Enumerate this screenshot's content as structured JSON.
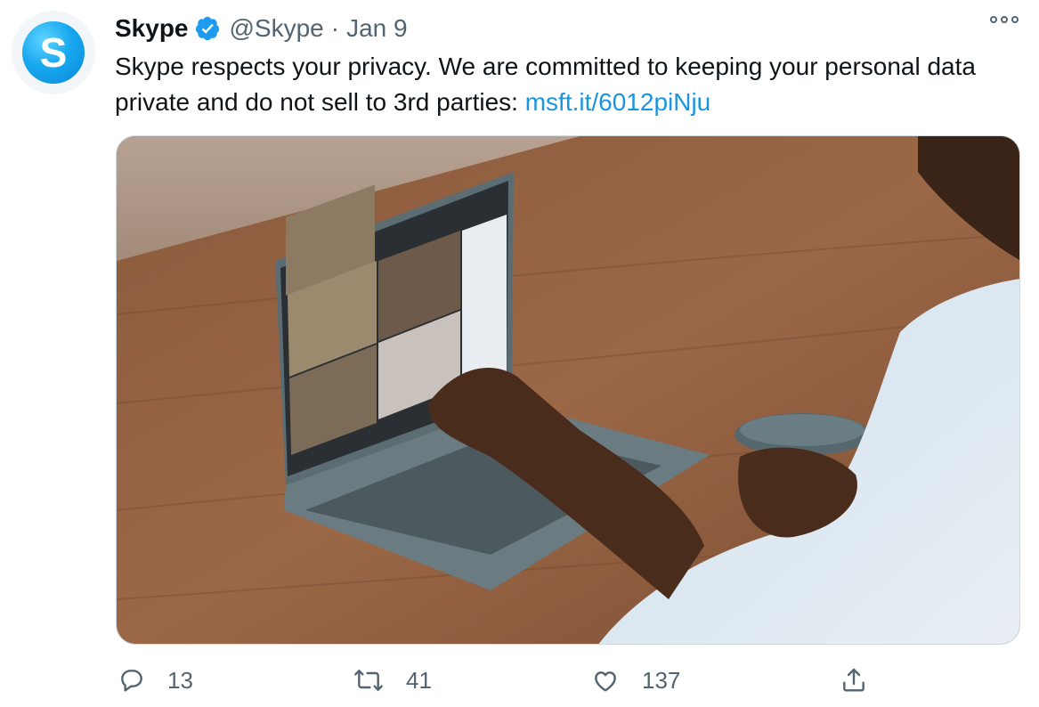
{
  "tweet": {
    "display_name": "Skype",
    "handle": "@Skype",
    "separator": "·",
    "date": "Jan 9",
    "avatar_letter": "S",
    "text": "Skype respects your privacy. We are committed to keeping your personal data private and do not sell to 3rd parties: ",
    "link_text": "msft.it/6012piNju"
  },
  "actions": {
    "reply_count": "13",
    "retweet_count": "41",
    "like_count": "137"
  },
  "colors": {
    "link": "#1b95e0",
    "verified": "#1d9bf0",
    "secondary_text": "#536471",
    "skype_brand": "#18a8ef"
  },
  "icons": [
    "verified-badge-icon",
    "more-options-icon",
    "reply-icon",
    "retweet-icon",
    "like-icon",
    "share-icon"
  ]
}
